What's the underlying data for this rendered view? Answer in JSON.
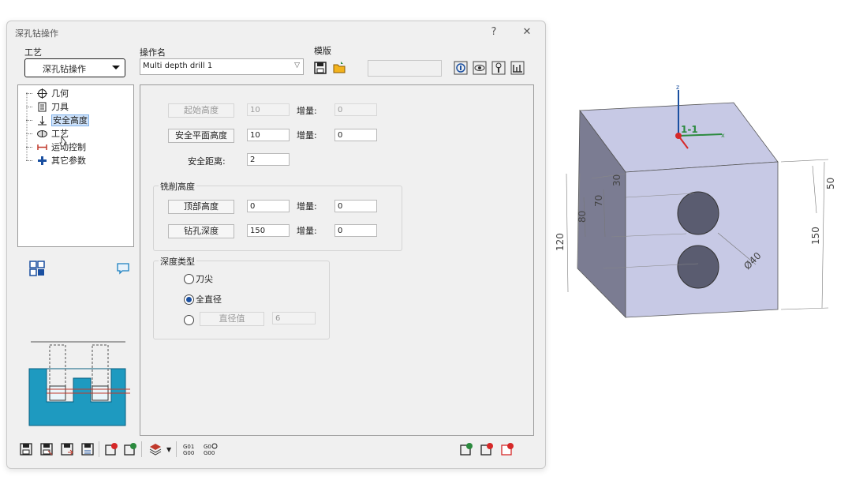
{
  "window": {
    "title": "深孔钻操作",
    "help": "?",
    "close": "✕"
  },
  "header": {
    "process_label": "工艺",
    "process_value": "深孔钻操作",
    "op_name_label": "操作名",
    "op_name_value": "Multi depth drill 1",
    "template_label": "模版"
  },
  "tree": {
    "items": [
      {
        "label": "几何",
        "icon": "crosshair-icon"
      },
      {
        "label": "刀具",
        "icon": "tool-icon"
      },
      {
        "label": "安全高度",
        "icon": "safe-height-icon",
        "selected": true
      },
      {
        "label": "工艺",
        "icon": "process-icon"
      },
      {
        "label": "运动控制",
        "icon": "motion-icon"
      },
      {
        "label": "其它参数",
        "icon": "plus-icon"
      }
    ]
  },
  "params": {
    "start_height": {
      "label": "起始高度",
      "value": "10",
      "inc_label": "增量:",
      "inc": "0"
    },
    "safe_plane": {
      "label": "安全平面高度",
      "value": "10",
      "inc_label": "增量:",
      "inc": "0"
    },
    "safe_dist": {
      "label": "安全距离:",
      "value": "2"
    },
    "cut_group": {
      "title": "铣削高度"
    },
    "top_height": {
      "label": "顶部高度",
      "value": "0",
      "inc_label": "增量:",
      "inc": "0"
    },
    "drill_depth": {
      "label": "钻孔深度",
      "value": "150",
      "inc_label": "增量:",
      "inc": "0"
    },
    "depth_type": {
      "title": "深度类型",
      "opt1": "刀尖",
      "opt2": "全直径",
      "opt3_btn": "直径值",
      "opt3_val": "6",
      "selected": "全直径"
    }
  },
  "colors": {
    "accent": "#1a4fa0",
    "part_face": "#c7c9e5",
    "part_side": "#7b7c92",
    "diagram_fill": "#1e9ac0"
  },
  "model": {
    "axis_z": "z",
    "axis_x": "x",
    "frame_label": "1-1",
    "dims": {
      "d30": "30",
      "d70": "70",
      "d80": "80",
      "d120": "120",
      "d50": "50",
      "d150": "150",
      "dia40": "Ø40"
    }
  }
}
